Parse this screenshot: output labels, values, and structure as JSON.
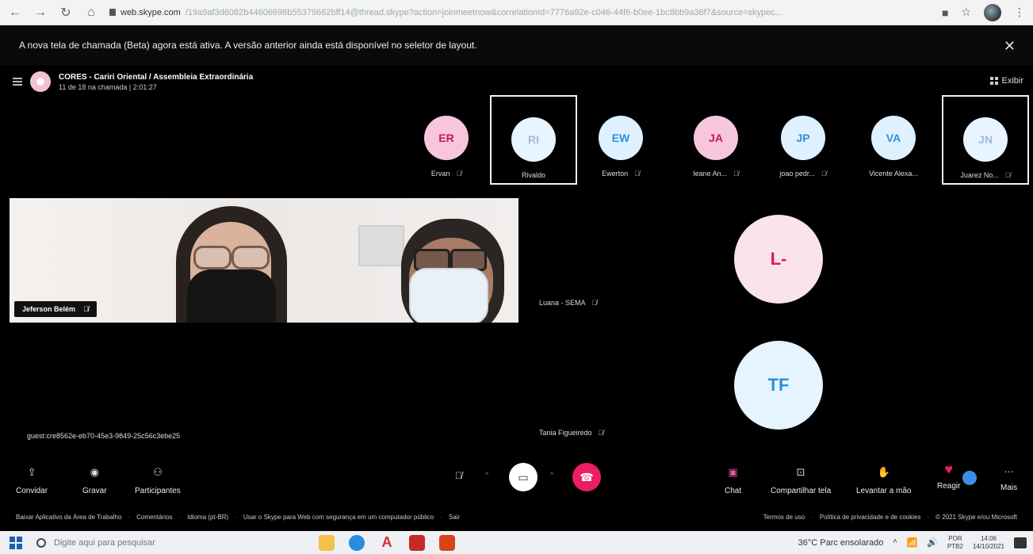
{
  "browser": {
    "url_host": "web.skype.com",
    "url_path": "/19a9af3d6082b44606698b55379662bff14@thread.skype?action=joinmeetnow&correlationId=7776a92e-c046-44f6-b0ee-1bc8bb9a36f7&source=skypec..."
  },
  "banner": {
    "text": "A nova tela de chamada (Beta) agora está ativa. A versão anterior ainda está disponível no seletor de layout.",
    "close": "✕"
  },
  "meeting": {
    "title": "CORES - Cariri Oriental / Assembleia Extraordinária",
    "subtitle": "11 de 18 na chamada | 2:01:27",
    "view_label": "Exibir"
  },
  "participants": [
    {
      "initials": "ER",
      "name": "Ervan",
      "color": "#f7c6dc",
      "text_color": "#c2185b",
      "highlight": false
    },
    {
      "initials": "RI",
      "name": "Rivaldo",
      "color": "#e8f4ff",
      "text_color": "#9fb9d4",
      "highlight": true
    },
    {
      "initials": "EW",
      "name": "Ewerton",
      "color": "#dff1ff",
      "text_color": "#2f8fd8",
      "highlight": false
    },
    {
      "initials": "JA",
      "name": "Ieane An...",
      "color": "#f7c6dc",
      "text_color": "#c2185b",
      "highlight": false
    },
    {
      "initials": "JP",
      "name": "joao pedr...",
      "color": "#dff1ff",
      "text_color": "#2f8fd8",
      "highlight": false
    },
    {
      "initials": "VA",
      "name": "Vicente Alexa...",
      "color": "#dff1ff",
      "text_color": "#2f8fd8",
      "highlight": false
    },
    {
      "initials": "JN",
      "name": "Juarez No...",
      "color": "#e8f4ff",
      "text_color": "#9fb9d4",
      "highlight": true
    }
  ],
  "video": {
    "name": "Jeferson Belém"
  },
  "tiles": {
    "luana": "Luana - SEMA",
    "tania": "Tania Figueiredo",
    "guest": "guest:cre8562e-eb70-45e3-9849-25c56c3ebe25"
  },
  "big_avatars": [
    {
      "initials": "L-",
      "color": "#fbe3ea",
      "text_color": "#d81b60"
    },
    {
      "initials": "TF",
      "color": "#e6f4ff",
      "text_color": "#2f8fd8"
    }
  ],
  "controls": {
    "invite": "Convidar",
    "record": "Gravar",
    "participants": "Participantes",
    "chat": "Chat",
    "share": "Compartilhar tela",
    "raise_hand": "Levantar a mão",
    "react": "Reagir",
    "more": "Mais"
  },
  "footer": {
    "left": [
      "Baixar Aplicativo da Área de Trabalho",
      "Comentários",
      "Idioma (pt-BR)",
      "Usar o Skype para Web com segurança em um computador público",
      "Sair"
    ],
    "right": [
      "Termos de uso",
      "Política de privacidade e de cookies",
      "© 2021 Skype e/ou Microsoft"
    ]
  },
  "taskbar": {
    "search_placeholder": "Digite aqui para pesquisar",
    "weather": "36°C  Parc ensolarado",
    "lang_top": "POR",
    "lang_bottom": "PTB2",
    "time": "14:06",
    "date": "14/10/2021"
  }
}
